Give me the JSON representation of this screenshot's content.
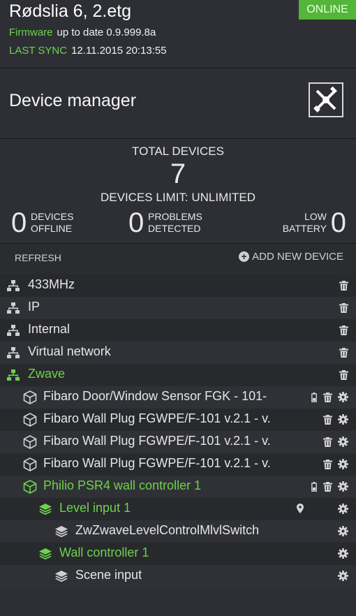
{
  "header": {
    "title": "Rødslia 6, 2.etg",
    "status": "ONLINE",
    "firmware_label": "Firmware",
    "firmware_value": "up to date 0.9.999.8a",
    "sync_label": "LAST SYNC",
    "sync_value": "12.11.2015 20:13:55"
  },
  "manager": {
    "title": "Device manager",
    "button_icon": "tools-icon"
  },
  "stats": {
    "total_label": "TOTAL DEVICES",
    "total_count": "7",
    "limit_label": "DEVICES LIMIT: UNLIMITED",
    "offline_count": "0",
    "offline_label_1": "DEVICES",
    "offline_label_2": "OFFLINE",
    "problems_count": "0",
    "problems_label_1": "PROBLEMS",
    "problems_label_2": "DETECTED",
    "battery_count": "0",
    "battery_label_1": "LOW",
    "battery_label_2": "BATTERY"
  },
  "toolbar": {
    "refresh": "REFRESH",
    "add_new": "ADD NEW DEVICE"
  },
  "networks": [
    {
      "label": "433MHz"
    },
    {
      "label": "IP"
    },
    {
      "label": "Internal"
    },
    {
      "label": "Virtual network"
    },
    {
      "label": "Zwave"
    }
  ],
  "devices": [
    {
      "label": "Fibaro Door/Window Sensor FGK - 101-"
    },
    {
      "label": "Fibaro Wall Plug FGWPE/F-101 v.2.1 - v."
    },
    {
      "label": "Fibaro Wall Plug FGWPE/F-101 v.2.1 - v."
    },
    {
      "label": "Fibaro Wall Plug FGWPE/F-101 v.2.1 - v."
    },
    {
      "label": "Philio PSR4 wall controller 1"
    }
  ],
  "sub_items": [
    {
      "label": "Level input 1"
    },
    {
      "label": "ZwZwaveLevelControlMlvlSwitch"
    },
    {
      "label": "Wall controller 1"
    },
    {
      "label": "Scene input"
    }
  ],
  "colors": {
    "accent_green": "#6cd34c",
    "online_bg": "#53b53a",
    "background": "#2e2f35"
  }
}
